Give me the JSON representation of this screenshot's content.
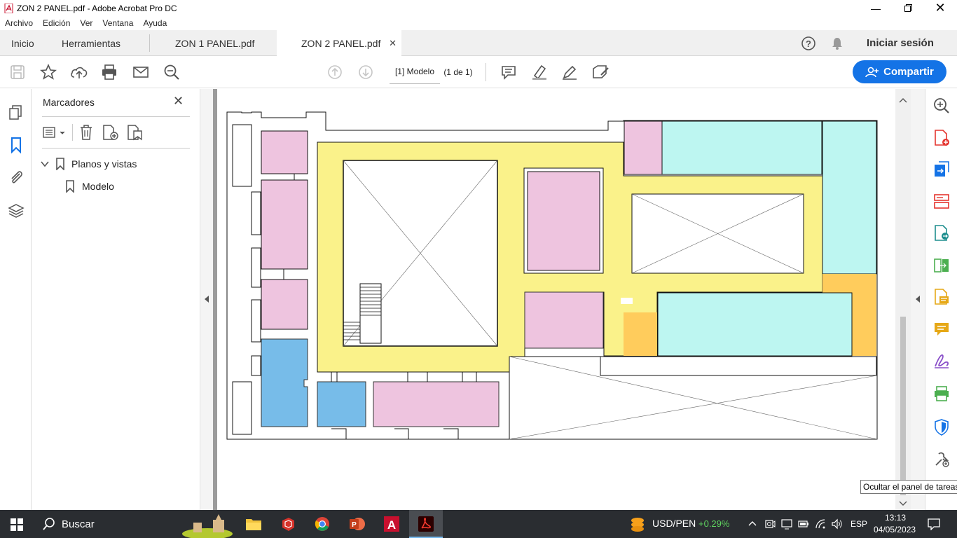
{
  "window": {
    "title": "ZON 2 PANEL.pdf - Adobe Acrobat Pro DC"
  },
  "menu": [
    "Archivo",
    "Edición",
    "Ver",
    "Ventana",
    "Ayuda"
  ],
  "tabs": {
    "home": "Inicio",
    "tools": "Herramientas",
    "doc1": "ZON 1 PANEL.pdf",
    "doc2": "ZON 2 PANEL.pdf"
  },
  "header": {
    "signin": "Iniciar sesión",
    "share": "Compartir"
  },
  "toolbar": {
    "page_label": "[1] Modelo",
    "page_count": "(1 de 1)"
  },
  "bookmarks": {
    "title": "Marcadores",
    "items": [
      "Planos y vistas",
      "Modelo"
    ]
  },
  "tooltip": "Ocultar el panel de tareas",
  "taskbar": {
    "search": "Buscar",
    "ticker": "USD/PEN",
    "ticker_change": "+0.29%",
    "lang": "ESP",
    "time": "13:13",
    "date": "04/05/2023"
  },
  "colors": {
    "accent": "#1473e6",
    "pink": "#eec4df",
    "cyan": "#bdf6f1",
    "yellow": "#faf28a",
    "blue": "#77bce9",
    "orange": "#ffcc5c",
    "ticker_up": "#5fd35f"
  }
}
